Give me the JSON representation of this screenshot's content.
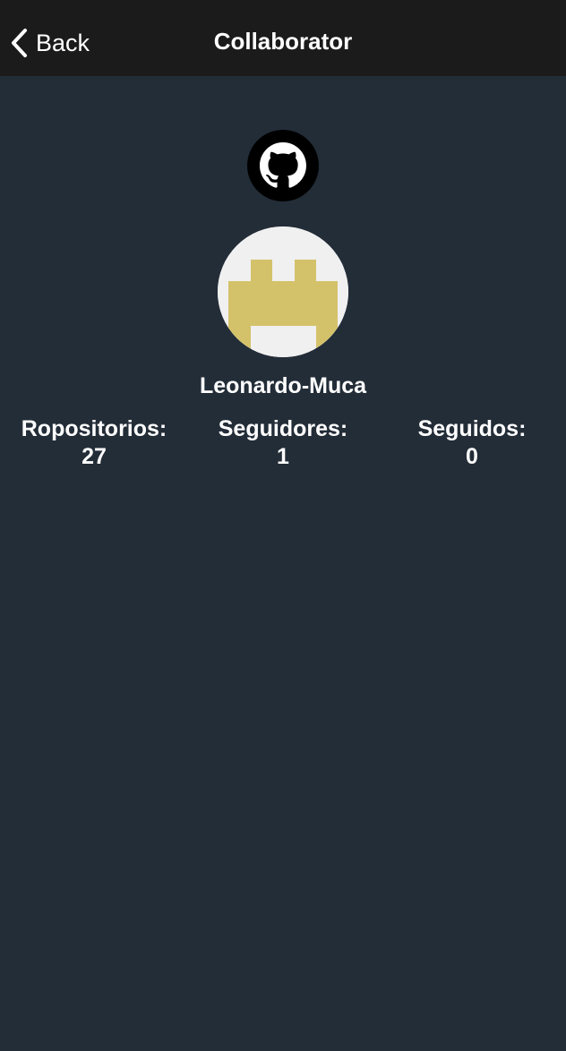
{
  "navbar": {
    "back_label": "Back",
    "title": "Collaborator",
    "background": "#1b1b1b"
  },
  "profile": {
    "badge_icon": "github-icon",
    "avatar_icon": "identicon-avatar",
    "avatar_color": "#d4c26a",
    "username": "Leonardo-Muca"
  },
  "stats": [
    {
      "label": "Ropositorios:",
      "value": "27"
    },
    {
      "label": "Seguidores:",
      "value": "1"
    },
    {
      "label": "Seguidos:",
      "value": "0"
    }
  ],
  "theme": {
    "background": "#232d38",
    "text": "#ffffff"
  }
}
